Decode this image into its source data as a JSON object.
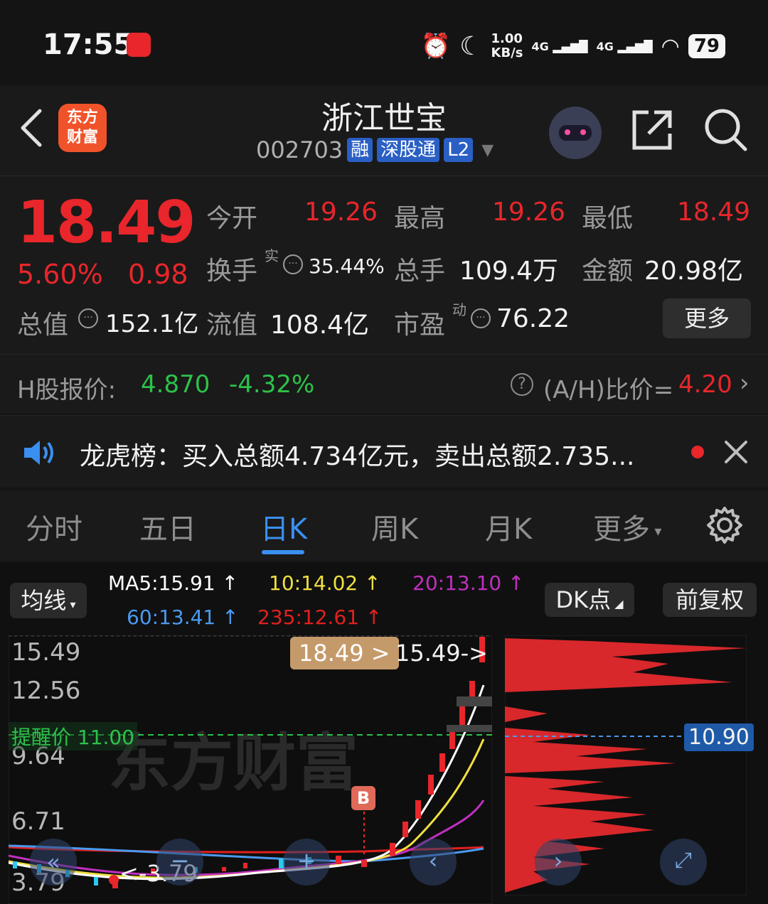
{
  "status_bar": {
    "time": "17:55",
    "net_speed_top": "1.00",
    "net_speed_bottom": "KB/s",
    "signal1": "4G",
    "signal2": "4G",
    "battery": "79"
  },
  "header": {
    "logo_line1": "东方",
    "logo_line2": "财富",
    "stock_name": "浙江世宝",
    "stock_code": "002703",
    "tags": [
      "融",
      "深股通",
      "L2"
    ]
  },
  "quote": {
    "price": "18.49",
    "change_pct": "5.60%",
    "change_amt": "0.98",
    "open_label": "今开",
    "open_value": "19.26",
    "high_label": "最高",
    "high_value": "19.26",
    "low_label": "最低",
    "low_value": "18.49",
    "turnover_label": "换手",
    "turnover_sup": "实",
    "turnover_value": "35.44%",
    "volume_label": "总手",
    "volume_value": "109.4万",
    "amount_label": "金额",
    "amount_value": "20.98亿",
    "mktcap_label": "总值",
    "mktcap_value": "152.1亿",
    "float_label": "流值",
    "float_value": "108.4亿",
    "pe_label": "市盈",
    "pe_sup": "动",
    "pe_value": "76.22",
    "more_label": "更多"
  },
  "hshare": {
    "label": "H股报价:",
    "price": "4.870",
    "change": "-4.32%",
    "ratio_label": "(A/H)比价=",
    "ratio_value": "4.20"
  },
  "notice": {
    "text": "龙虎榜：买入总额4.734亿元，卖出总额2.735..."
  },
  "tabs": {
    "items": [
      "分时",
      "五日",
      "日K",
      "周K",
      "月K",
      "更多"
    ],
    "active": "日K"
  },
  "chart": {
    "ma_selector": "均线",
    "ma5": "MA5:15.91",
    "ma10": "10:14.02",
    "ma20": "20:13.10",
    "ma60": "60:13.41",
    "ma235": "235:12.61",
    "arrow": "↑",
    "dk_label": "DK点",
    "adjust_label": "前复权",
    "y_labels": [
      "15.49",
      "12.56",
      "9.64",
      "6.71",
      "3.79"
    ],
    "price_tag": "18.49 >",
    "high_marker": "15.49->",
    "low_marker": "<-3.79",
    "alert_label": "提醒价 11.00",
    "buy_signal": "B",
    "watermark": "东方财富",
    "chip_price": "10.90",
    "colors": {
      "ma5": "#ffffff",
      "ma10": "#f0e040",
      "ma20": "#c030c0",
      "ma60": "#4a9af0",
      "ma235": "#e02020",
      "up": "#e8262b",
      "down": "#2cc8f0"
    }
  }
}
